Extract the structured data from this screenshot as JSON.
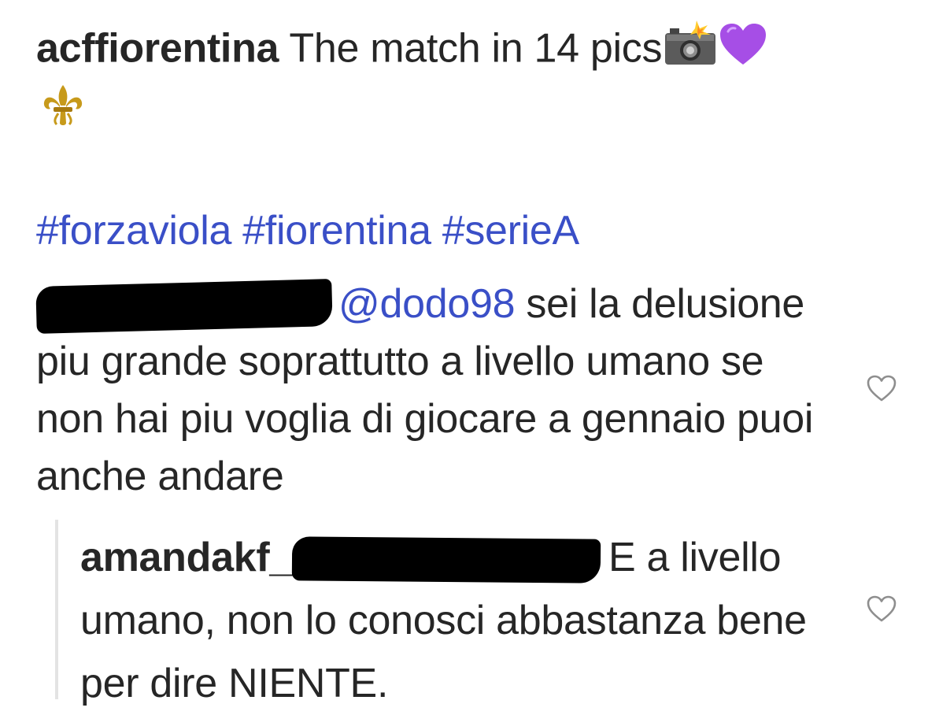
{
  "post": {
    "username": "acffiorentina",
    "caption_text": "The match in 14 pics",
    "caption_emojis": [
      "camera-flash-icon",
      "purple-heart-icon",
      "fleur-de-lis-icon"
    ],
    "hashtags": [
      "#forzaviola",
      "#fiorentina",
      "#serieA"
    ]
  },
  "comments": [
    {
      "username_redacted": true,
      "mention": "@dodo98",
      "text_line1": "sei la",
      "text_rest": "delusione piu grande soprattutto a livello umano se non hai piu voglia di giocare a gennaio puoi anche andare",
      "like_icon": "heart-outline-icon"
    }
  ],
  "replies": [
    {
      "username": "amandakf_",
      "mention_redacted": true,
      "text_line1": "E a",
      "text_rest": "livello umano, non lo conosci abbastanza bene per dire NIENTE.",
      "like_icon": "heart-outline-icon"
    }
  ],
  "colors": {
    "text": "#262626",
    "link": "#3a4fc7",
    "thread_line": "#e3e3e3",
    "purple_heart": "#a64ee6",
    "fleur_gold": "#c79a1b"
  }
}
